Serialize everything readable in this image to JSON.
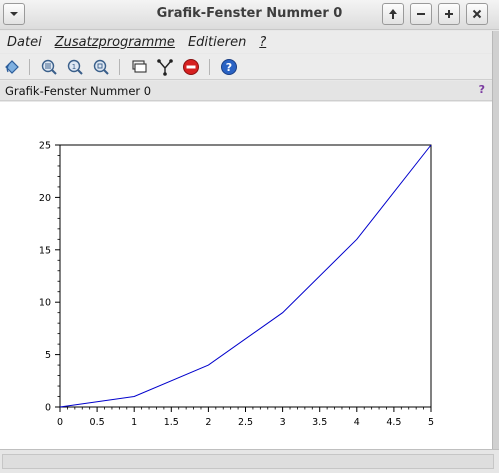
{
  "window": {
    "title": "Grafik-Fenster Nummer 0",
    "menu_icon": "chevron-down-icon",
    "buttons": [
      "arrow-up-icon",
      "minimize-icon",
      "maximize-icon",
      "close-icon"
    ]
  },
  "menubar": {
    "items": [
      {
        "label": "Datei",
        "underlined": false
      },
      {
        "label": "Zusatzprogramme",
        "underlined": true
      },
      {
        "label": "Editieren",
        "underlined": false
      },
      {
        "label": "?",
        "underlined": true
      }
    ]
  },
  "toolbar": {
    "icons": [
      "rotate-icon",
      "zoom-grid-icon",
      "zoom-in-icon",
      "zoom-out-icon",
      "datatip-icon",
      "edit-axes-icon",
      "stop-icon",
      "help-icon"
    ]
  },
  "subheader": {
    "title": "Grafik-Fenster Nummer 0",
    "help": "?"
  },
  "colors": {
    "line": "#0000cc",
    "stop": "#d62020",
    "help": "#2a63c4"
  },
  "chart_data": {
    "type": "line",
    "x": [
      0,
      1,
      2,
      3,
      4,
      5
    ],
    "series": [
      {
        "values": [
          0,
          1,
          4,
          9,
          16,
          25
        ]
      }
    ],
    "xlim": [
      0,
      5
    ],
    "ylim": [
      0,
      25
    ],
    "xticks": [
      "0",
      "0.5",
      "1",
      "1.5",
      "2",
      "2.5",
      "3",
      "3.5",
      "4",
      "4.5",
      "5"
    ],
    "yticks": [
      "0",
      "5",
      "10",
      "15",
      "20",
      "25"
    ],
    "grid": false,
    "title": "",
    "xlabel": "",
    "ylabel": ""
  }
}
